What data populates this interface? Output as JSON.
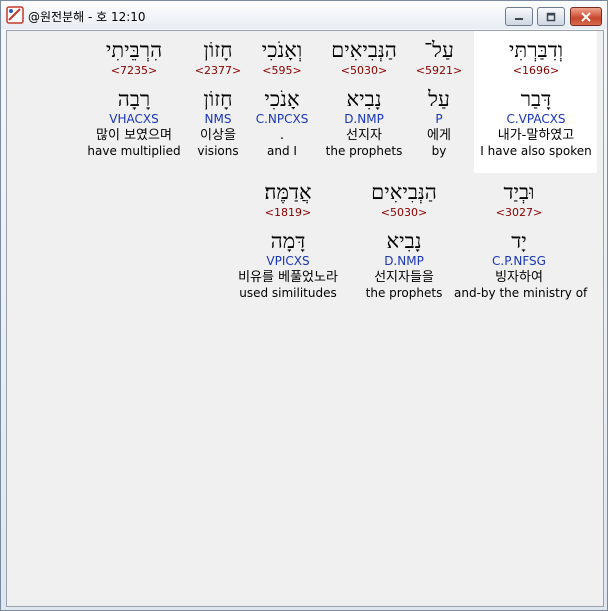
{
  "window": {
    "title": "@원전분해 - 호 12:10"
  },
  "verse_line1": [
    {
      "surface": "וְדִבַּרְתִּי",
      "strong": "<1696>",
      "lemma": "דָּבַר",
      "parse": "C.VPACXS",
      "kor": "내가-말하였고",
      "eng": "I have also spoken"
    },
    {
      "surface": "עַל־",
      "strong": "<5921>",
      "lemma": "עַל",
      "parse": "P",
      "kor": "에게",
      "eng": "by"
    },
    {
      "surface": "הַנְּבִיאִים",
      "strong": "<5030>",
      "lemma": "נָבִיא",
      "parse": "D.NMP",
      "kor": "선지자",
      "eng": "the prophets"
    },
    {
      "surface": "וְאָנֹכִי",
      "strong": "<595>",
      "lemma": "אָנֹכִי",
      "parse": "C.NPCXS",
      "kor": ".",
      "eng": "and I"
    },
    {
      "surface": "חָזוֹן",
      "strong": "<2377>",
      "lemma": "חָזוֹן",
      "parse": "NMS",
      "kor": "이상을",
      "eng": "visions"
    },
    {
      "surface": "הִרְבֵּיתִי",
      "strong": "<7235>",
      "lemma": "רָבָה",
      "parse": "VHACXS",
      "kor": "많이 보였으며",
      "eng": "have multiplied"
    }
  ],
  "verse_line2": [
    {
      "surface": "וּבְיַד",
      "strong": "<3027>",
      "lemma": "יָד",
      "parse": "C.P.NFSG",
      "kor": "빙자하여",
      "eng": "and-by the ministry of"
    },
    {
      "surface": "הַנְּבִיאִים",
      "strong": "<5030>",
      "lemma": "נָבִיא",
      "parse": "D.NMP",
      "kor": "선지자들을",
      "eng": "the prophets"
    },
    {
      "surface": "אֲדַמֶּה׃",
      "strong": "<1819>",
      "lemma": "דָּמָה",
      "parse": "VPICXS",
      "kor": "비유를 베풀었노라",
      "eng": "used similitudes"
    }
  ],
  "colors": {
    "strong": "#8b0000",
    "parse": "#1a35b8",
    "highlight": "#ffffff"
  }
}
